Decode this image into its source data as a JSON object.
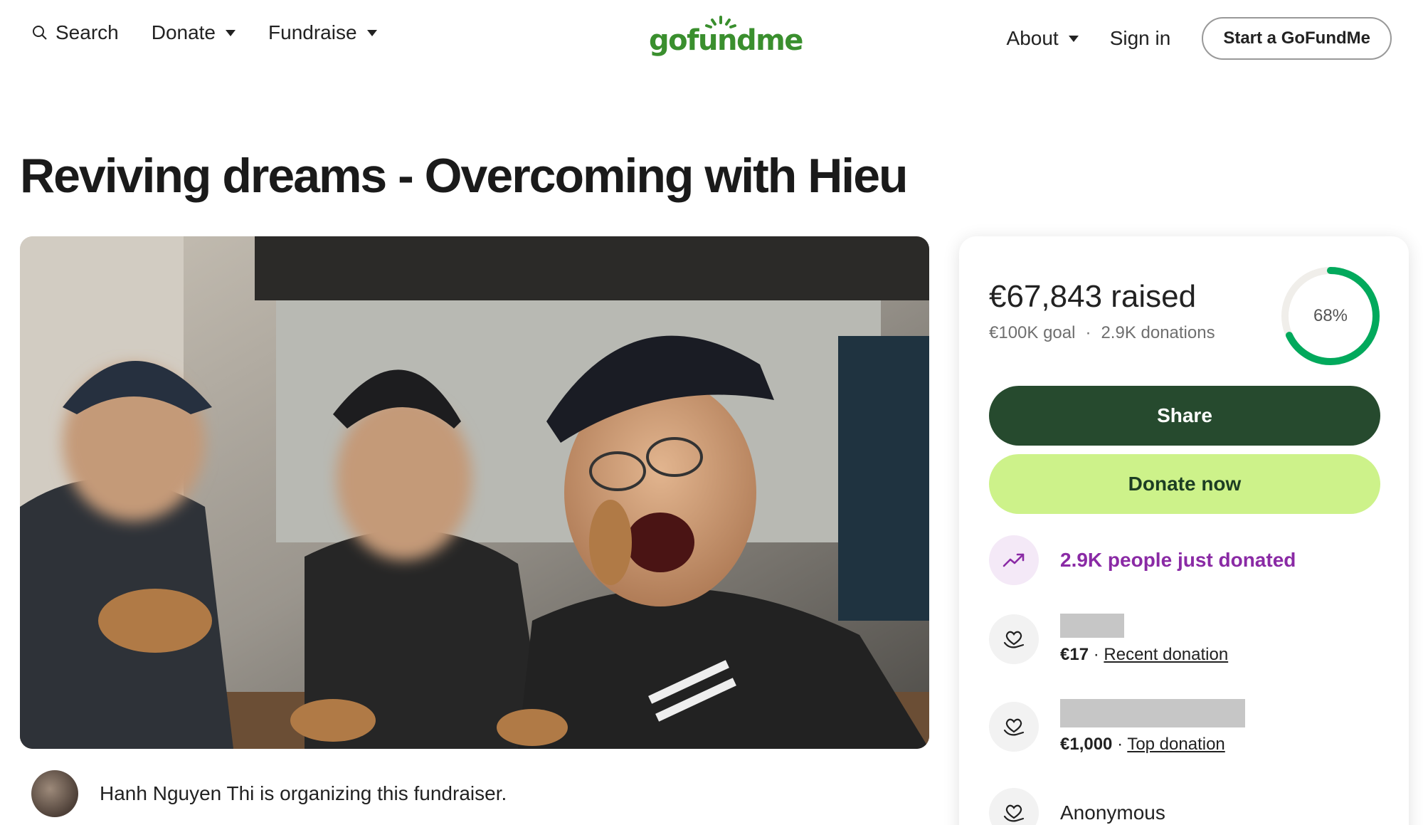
{
  "header": {
    "search_label": "Search",
    "donate_label": "Donate",
    "fundraise_label": "Fundraise",
    "logo_text": "gofundme",
    "about_label": "About",
    "signin_label": "Sign in",
    "start_label": "Start a GoFundMe"
  },
  "campaign": {
    "title": "Reviving dreams - Overcoming with Hieu",
    "organizer_text": "Hanh Nguyen Thi is organizing this fundraiser."
  },
  "stats": {
    "raised": "€67,843 raised",
    "goal": "€100K goal",
    "separator": "·",
    "donations": "2.9K donations",
    "percent_label": "68%",
    "percent_value": 0.68
  },
  "actions": {
    "share_label": "Share",
    "donate_label": "Donate now"
  },
  "activity": {
    "trend_text": "2.9K people just donated"
  },
  "donations_list": [
    {
      "amount": "€17",
      "separator": "·",
      "type": "Recent donation"
    },
    {
      "amount": "€1,000",
      "separator": "·",
      "type": "Top donation"
    },
    {
      "name": "Anonymous"
    }
  ],
  "colors": {
    "brand_green": "#3a8f2e",
    "share_bg": "#264a2e",
    "donate_bg": "#cdf28a",
    "progress": "#02a95c",
    "trend_purple": "#8a2aa5"
  }
}
